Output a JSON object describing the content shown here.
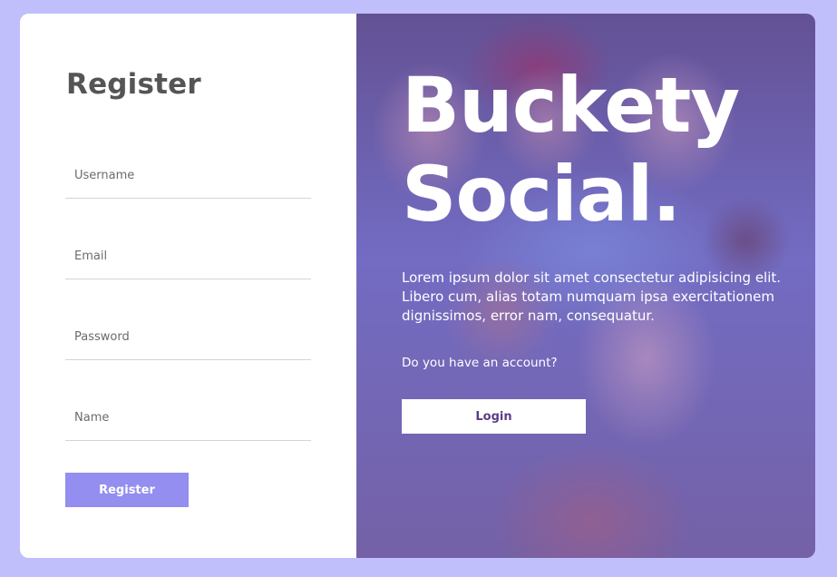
{
  "register": {
    "title": "Register",
    "fields": {
      "username_placeholder": "Username",
      "email_placeholder": "Email",
      "password_placeholder": "Password",
      "name_placeholder": "Name"
    },
    "button_label": "Register"
  },
  "hero": {
    "brand_line1": "Buckety",
    "brand_line2": "Social.",
    "description": "Lorem ipsum dolor sit amet consectetur adipisicing elit. Libero cum, alias totam numquam ipsa exercitationem dignissimos, error nam, consequatur.",
    "account_question": "Do you have an account?",
    "login_label": "Login"
  },
  "colors": {
    "page_background": "#c0bffc",
    "register_button": "#938eef",
    "overlay": "#5c48be",
    "login_text": "#5b3d86"
  }
}
